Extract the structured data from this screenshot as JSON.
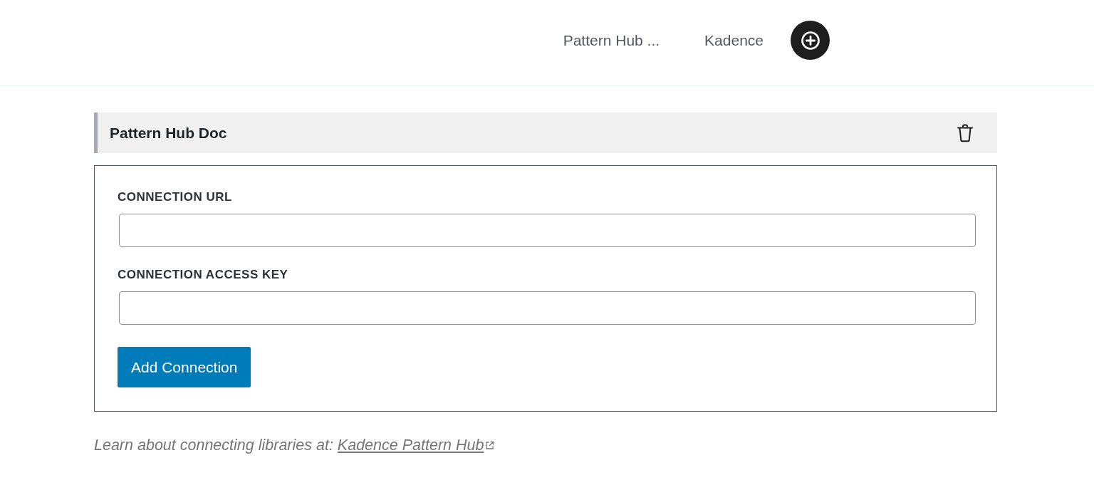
{
  "header": {
    "tabs": [
      {
        "label": "Pattern Hub ..."
      },
      {
        "label": "Kadence"
      }
    ]
  },
  "library": {
    "title": "Pattern Hub Doc",
    "fields": [
      {
        "label": "CONNECTION URL"
      },
      {
        "label": "CONNECTION ACCESS KEY"
      }
    ],
    "button": "Add Connection"
  },
  "note": {
    "text": "Learn about connecting libraries at:",
    "link": "Kadence Pattern Hub"
  }
}
